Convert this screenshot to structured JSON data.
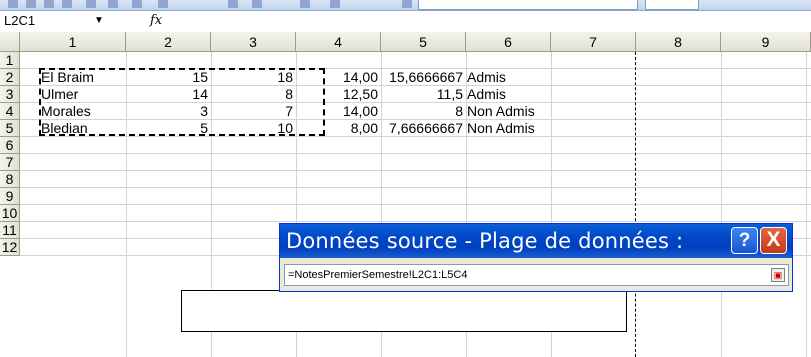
{
  "formula_bar": {
    "name_box": "L2C1",
    "fx_label": "fx",
    "formula": ""
  },
  "columns": [
    "1",
    "2",
    "3",
    "4",
    "5",
    "6",
    "7",
    "8",
    "9"
  ],
  "rows": [
    "1",
    "2",
    "3",
    "4",
    "5",
    "6",
    "7",
    "8",
    "9",
    "10",
    "11",
    "12"
  ],
  "table": [
    [
      "El Braim",
      "15",
      "18",
      "14,00",
      "15,6666667",
      "Admis"
    ],
    [
      "Ulmer",
      "14",
      "8",
      "12,50",
      "11,5",
      "Admis"
    ],
    [
      "Morales",
      "3",
      "7",
      "14,00",
      "8",
      "Non Admis"
    ],
    [
      "Bledian",
      "5",
      "10",
      "8,00",
      "7,66666667",
      "Non Admis"
    ]
  ],
  "dialog": {
    "title": "Données source - Plage de données :",
    "help_label": "?",
    "close_label": "X",
    "range_value": "=NotesPremierSemestre!L2C1:L5C4"
  },
  "colors": {
    "title_bar": "#0047c7",
    "close": "#c4381a",
    "grid_lines": "#d4d4d4"
  }
}
